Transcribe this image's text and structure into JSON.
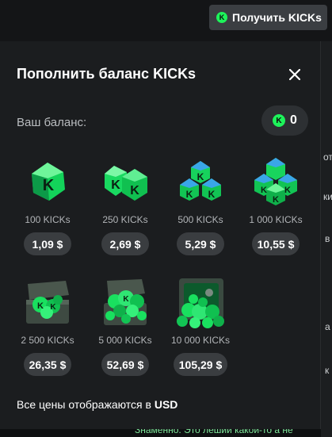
{
  "header": {
    "get_button_label": "Получить KICKs"
  },
  "modal": {
    "title": "Пополнить баланс KICKs",
    "balance_label": "Ваш баланс:",
    "balance_value": "0",
    "footer_text": "Все цены отображаются в",
    "footer_currency": "USD",
    "packs": [
      {
        "label": "100 KICKs",
        "price": "1,09 $",
        "icon": "gem-single-icon"
      },
      {
        "label": "250 KICKs",
        "price": "2,69 $",
        "icon": "gem-pair-icon"
      },
      {
        "label": "500 KICKs",
        "price": "5,29 $",
        "icon": "gem-cluster-three-icon"
      },
      {
        "label": "1 000 KICKs",
        "price": "10,55 $",
        "icon": "gem-cluster-four-icon"
      },
      {
        "label": "2 500 KICKs",
        "price": "26,35 $",
        "icon": "treasure-chest-small-icon"
      },
      {
        "label": "5 000 KICKs",
        "price": "52,69 $",
        "icon": "treasure-chest-large-icon"
      },
      {
        "label": "10 000 KICKs",
        "price": "105,29 $",
        "icon": "vault-icon"
      }
    ]
  },
  "background_text": [
    "от",
    "ки",
    "в",
    "а",
    "к",
    "Знаменно. Это лешии какой-то а не"
  ],
  "colors": {
    "accent": "#1df35a",
    "modal_bg": "#1b1d1f",
    "pill_bg": "#3a3d40"
  }
}
